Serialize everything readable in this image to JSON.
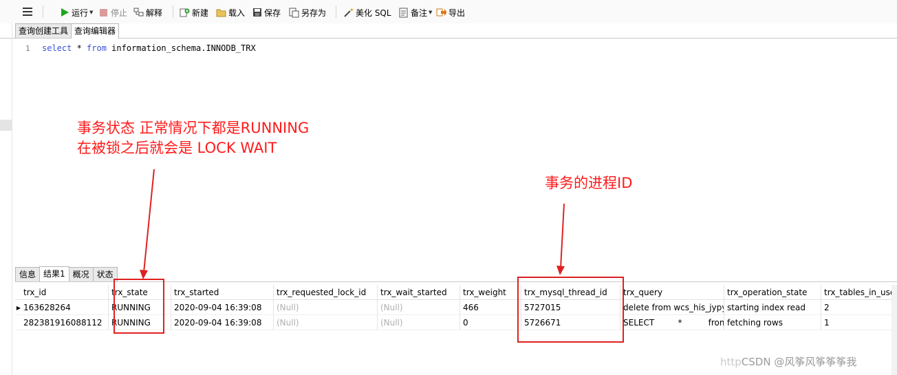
{
  "toolbar": {
    "run_label": "运行",
    "stop_label": "停止",
    "explain_label": "解释",
    "new_label": "新建",
    "load_label": "载入",
    "save_label": "保存",
    "saveas_label": "另存为",
    "beautify_label": "美化 SQL",
    "note_label": "备注",
    "export_label": "导出"
  },
  "editor_tabs": [
    "查询创建工具",
    "查询编辑器"
  ],
  "editor": {
    "line_number": "1",
    "sql_kw1": "select",
    "sql_star": " * ",
    "sql_kw2": "from",
    "sql_rest": " information_schema.INNODB_TRX"
  },
  "annotations": {
    "state_line1": "事务状态 正常情况下都是RUNNING",
    "state_line2": "在被锁之后就会是 LOCK WAIT",
    "thread_note": "事务的进程ID",
    "color": "#ff1a1a"
  },
  "result_tabs": [
    "信息",
    "结果1",
    "概况",
    "状态"
  ],
  "grid": {
    "columns": [
      "trx_id",
      "trx_state",
      "trx_started",
      "trx_requested_lock_id",
      "trx_wait_started",
      "trx_weight",
      "trx_mysql_thread_id",
      "trx_query",
      "trx_operation_state",
      "trx_tables_in_use"
    ],
    "rows": [
      [
        "163628264",
        "RUNNING",
        "2020-09-04 16:39:08",
        "(Null)",
        "(Null)",
        "466",
        "5727015",
        "delete from wcs_his_jypyjg",
        "starting index read",
        "2"
      ],
      [
        "282381916088112",
        "RUNNING",
        "2020-09-04 16:39:08",
        "(Null)",
        "(Null)",
        "0",
        "5726671",
        "SELECT         *          from",
        "fetching rows",
        "1"
      ]
    ]
  },
  "watermark": {
    "faint": "http",
    "label": "CSDN @风筝风筝筝筝我"
  }
}
